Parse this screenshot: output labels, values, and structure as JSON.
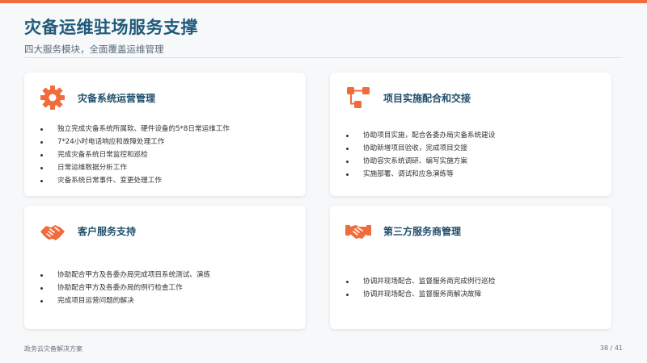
{
  "header": {
    "title": "灾备运维驻场服务支撑",
    "subtitle": "四大服务模块，全面覆盖运维管理"
  },
  "cards": [
    {
      "icon": "gear-icon",
      "title": "灾备系统运营管理",
      "items": [
        "独立完成灾备系统所属软、硬件设备的5*8日常运维工作",
        "7*24小时电话响应和故障处理工作",
        "完成灾备系统日常监控和巡检",
        "日常运维数据分析工作",
        "灾备系统日常事件、变更处理工作"
      ]
    },
    {
      "icon": "flow-icon",
      "title": "项目实施配合和交接",
      "items": [
        "协助项目实施，配合各委办局灾备系统建设",
        "协助新增项目验收，完成项目交接",
        "协助容灾系统调研、编写实施方案",
        "实施部署、调试和应急演练等"
      ]
    },
    {
      "icon": "handshake-icon",
      "title": "客户服务支持",
      "items": [
        "协助配合甲方及各委办局完成项目系统测试、演练",
        "协助配合甲方及各委办局的例行检查工作",
        "完成项目运营问题的解决"
      ]
    },
    {
      "icon": "partnership-icon",
      "title": "第三方服务商管理",
      "items": [
        "协调并现场配合、监督服务商完成例行巡检",
        "协调并现场配合、监督服务商解决故障"
      ]
    }
  ],
  "footer": {
    "left": "政务云灾备解决方案",
    "page": "38 / 41"
  },
  "colors": {
    "accent": "#f26b3a",
    "title": "#1f5a7a",
    "card_title": "#1f4e6b"
  }
}
